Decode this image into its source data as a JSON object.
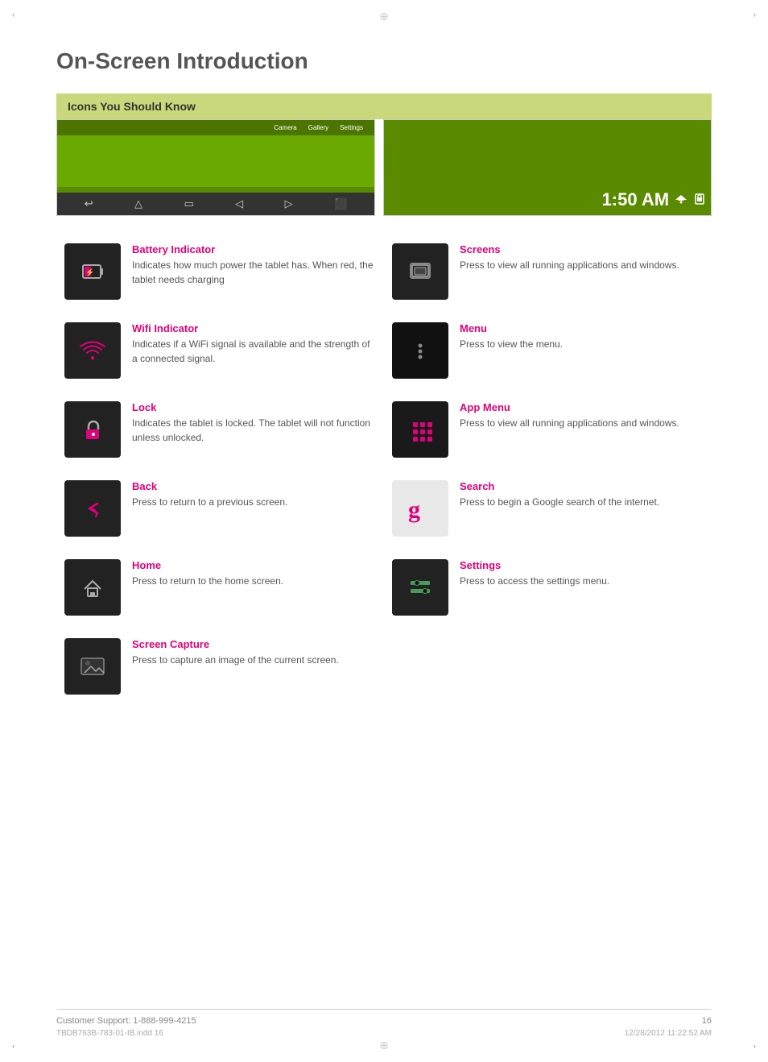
{
  "page": {
    "title": "On-Screen Introduction",
    "section_header": "Icons You Should Know",
    "footer": {
      "support_text": "Customer Support:  1-888-999-4215",
      "page_number": "16",
      "meta_left": "TBDB763B-783-01-IB.indd   16",
      "meta_right": "12/28/2012   11:22:52 AM"
    }
  },
  "device_left": {
    "tabs": [
      "Camera",
      "Gallery",
      "Settings"
    ],
    "bottom_buttons": [
      "↩",
      "△",
      "□",
      "◁",
      "◁▸",
      "⬛"
    ]
  },
  "device_right": {
    "time": "1:50 AM",
    "icons": "📶🔒"
  },
  "icons": [
    {
      "id": "battery",
      "label": "Battery Indicator",
      "desc": "Indicates how much power the tablet has. When red, the tablet needs charging",
      "side": "left"
    },
    {
      "id": "screens",
      "label": "Screens",
      "desc": "Press to view all running applications and windows.",
      "side": "right"
    },
    {
      "id": "wifi",
      "label": "Wifi Indicator",
      "desc": "Indicates if a WiFi signal is available and the strength of a connected signal.",
      "side": "left"
    },
    {
      "id": "menu",
      "label": "Menu",
      "desc": "Press to view the menu.",
      "side": "right"
    },
    {
      "id": "lock",
      "label": "Lock",
      "desc": "Indicates the tablet is locked. The tablet will not function unless unlocked.",
      "side": "left"
    },
    {
      "id": "appmenu",
      "label": "App Menu",
      "desc": "Press to view all running applications and windows.",
      "side": "right"
    },
    {
      "id": "back",
      "label": "Back",
      "desc": "Press to return to a previous screen.",
      "side": "left"
    },
    {
      "id": "search",
      "label": "Search",
      "desc": "Press to begin a Google search of the internet.",
      "side": "right"
    },
    {
      "id": "home",
      "label": "Home",
      "desc": "Press to return to the home screen.",
      "side": "left"
    },
    {
      "id": "settings",
      "label": "Settings",
      "desc": "Press to access the settings menu.",
      "side": "right"
    },
    {
      "id": "screencapture",
      "label": "Screen Capture",
      "desc": "Press to capture an image of the current screen.",
      "side": "left"
    }
  ]
}
